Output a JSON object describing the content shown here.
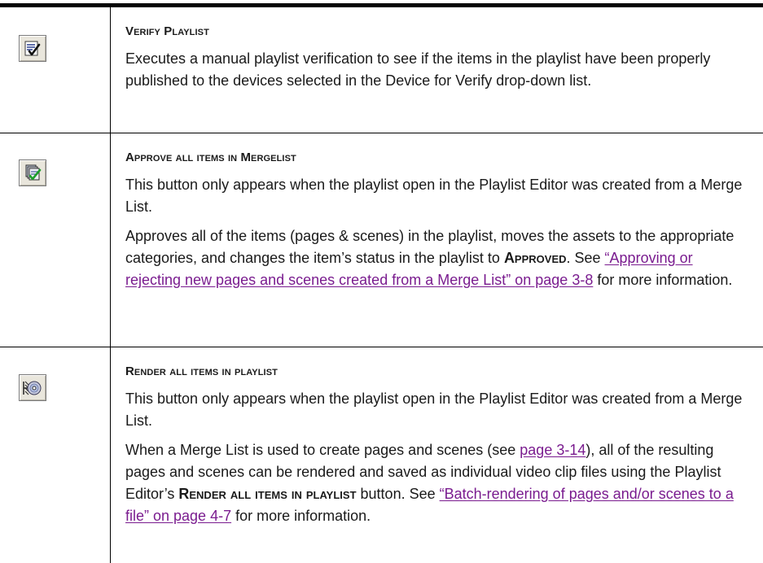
{
  "rows": [
    {
      "heading": "Verify Playlist",
      "icon": "verify-playlist-icon",
      "paragraphs": [
        "Executes a manual playlist verification to see if the items in the playlist have been properly published to the devices selected in the Device for Verify drop-down list."
      ]
    },
    {
      "heading": "Approve all items in Mergelist",
      "icon": "approve-all-icon",
      "p1": "This button only appears when the playlist open in the Playlist Editor was created from a Merge List.",
      "p2_a": "Approves all of the items (pages & scenes) in the playlist, moves the assets to the appropriate categories, and changes the item’s status in the playlist to ",
      "p2_em": "Approved",
      "p2_b": ". See ",
      "p2_link": "“Approving or rejecting new pages and scenes created from a Merge List” on page 3-8",
      "p2_c": " for more information."
    },
    {
      "heading": "Render all items in playlist",
      "icon": "render-all-icon",
      "p1": "This button only appears when the playlist open in the Playlist Editor was created from a Merge List.",
      "p2_a": "When a Merge List is used to create pages and scenes (see ",
      "p2_link1": "page 3-14",
      "p2_b": "), all of the resulting pages and scenes can be rendered and saved as individual video clip files using the Playlist Editor’s ",
      "p2_em": "Render all items in playlist",
      "p2_c": " button. See ",
      "p2_link2": "“Batch-rendering of pages and/or scenes to a file” on page 4-7",
      "p2_d": " for more information."
    }
  ]
}
